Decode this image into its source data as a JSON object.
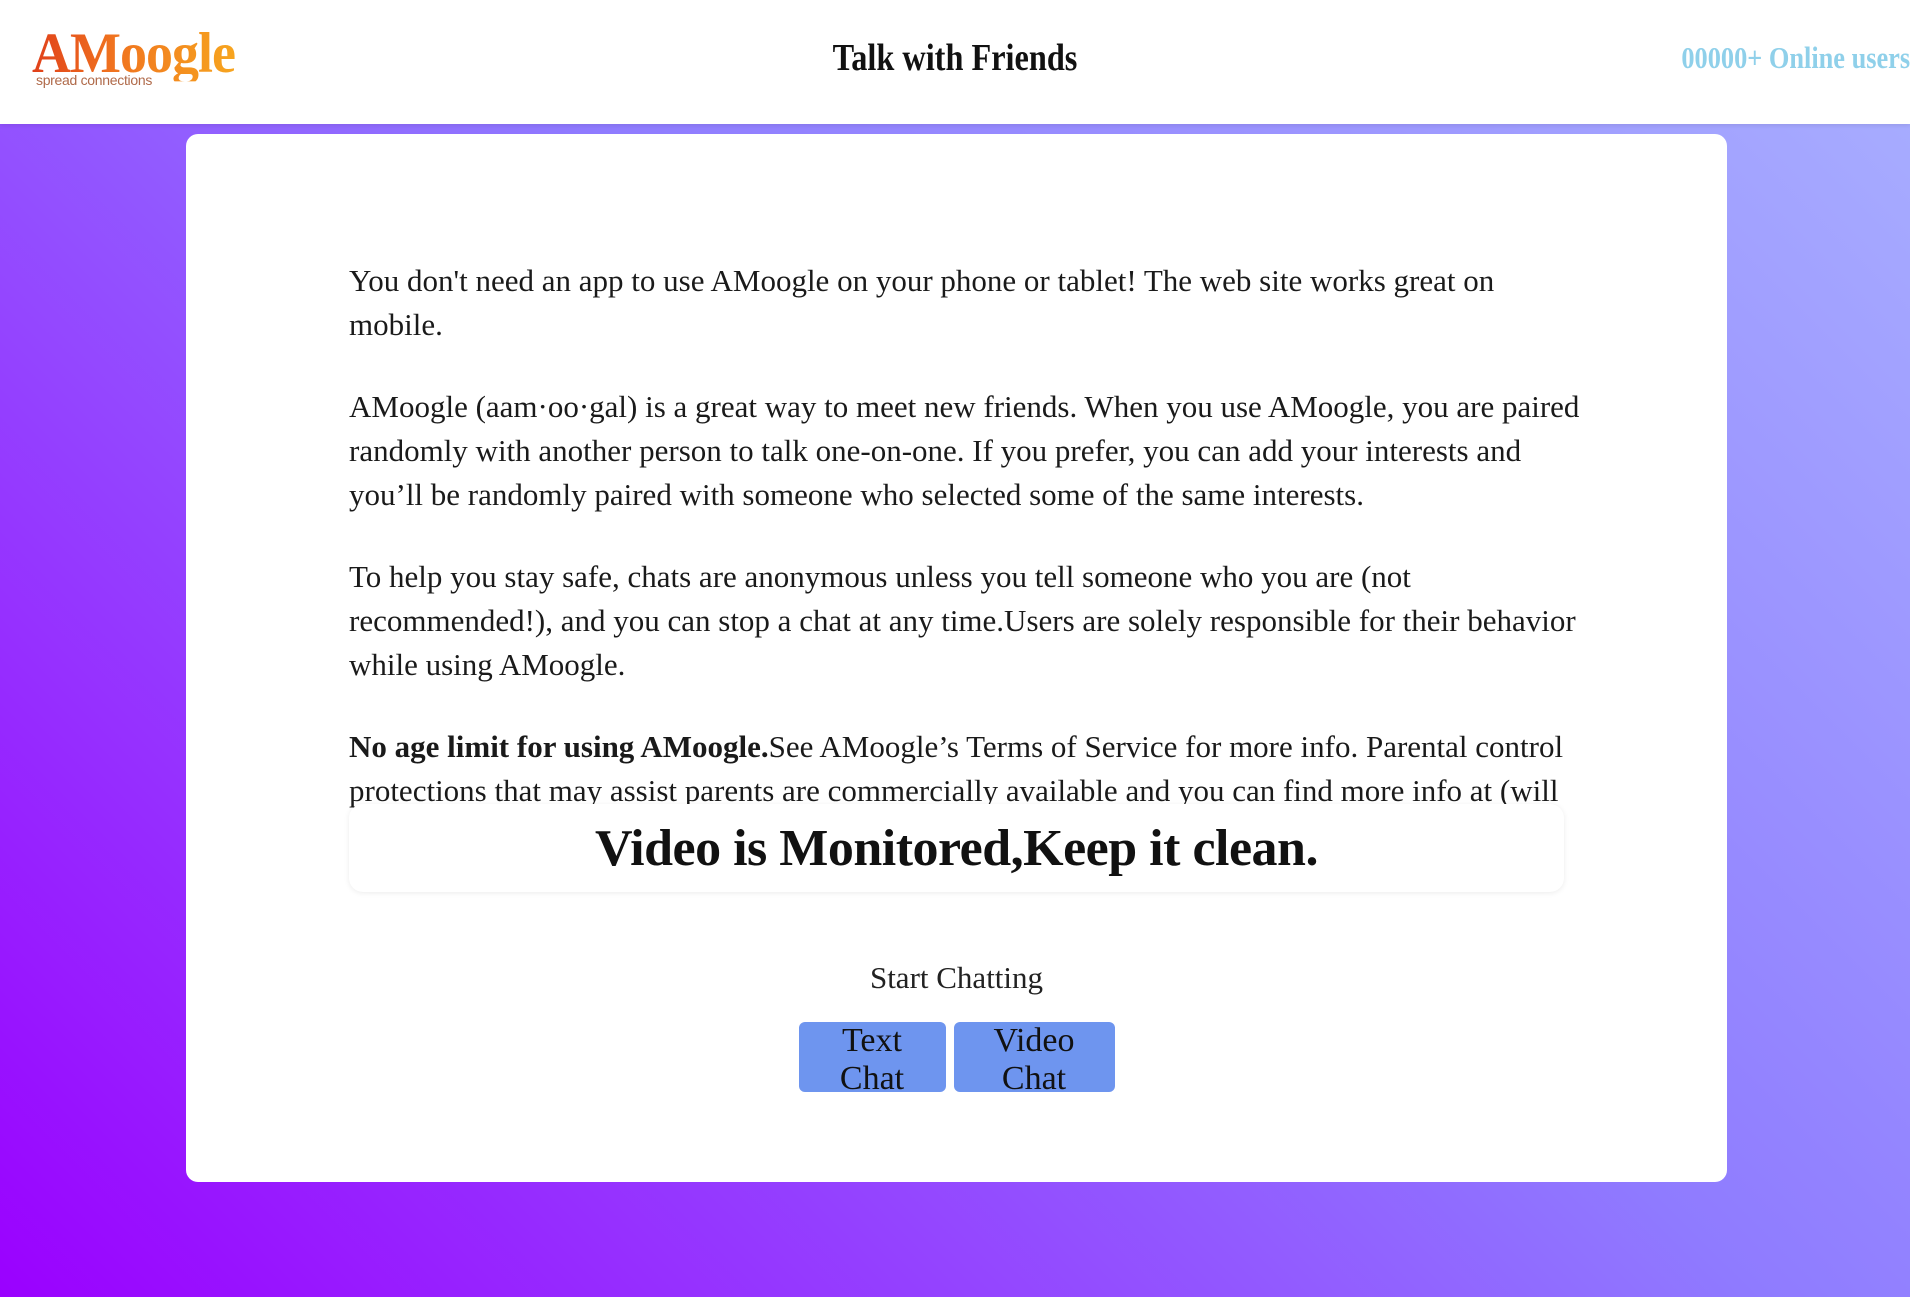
{
  "header": {
    "logo_text": "AMoogle",
    "logo_tagline": "spread connections",
    "title": "Talk with Friends",
    "online_users": "00000+ Online users"
  },
  "main": {
    "paragraphs": {
      "p1": "You don't need an app to use AMoogle on your phone or tablet! The web site works great on mobile.",
      "p2": "AMoogle (aam·oo·gal) is a great way to meet new friends. When you use AMoogle, you are paired randomly with another person to talk one-on-one. If you prefer, you can add your interests and you’ll be randomly paired with someone who selected some of the same interests.",
      "p3": "To help you stay safe, chats are anonymous unless you tell someone who you are (not recommended!), and you can stop a chat at any time.Users are solely responsible for their behavior while using AMoogle.",
      "p4_bold": "No age limit for using AMoogle.",
      "p4_rest": "See AMoogle’s Terms of Service for more info. Parental control protections that may assist parents are commercially available and you can find more info at (will update n future) as well as other sites."
    },
    "notice": "Video is Monitored,Keep it clean.",
    "start_label": "Start Chatting",
    "buttons": {
      "text_chat": "Text Chat",
      "video_chat": "Video Chat"
    }
  },
  "colors": {
    "button_bg": "#6e95ef",
    "online_text": "#8fd0ea",
    "logo_orange": "#f0731f",
    "background_start": "#9a00ff",
    "background_end": "#a9b0ff"
  }
}
